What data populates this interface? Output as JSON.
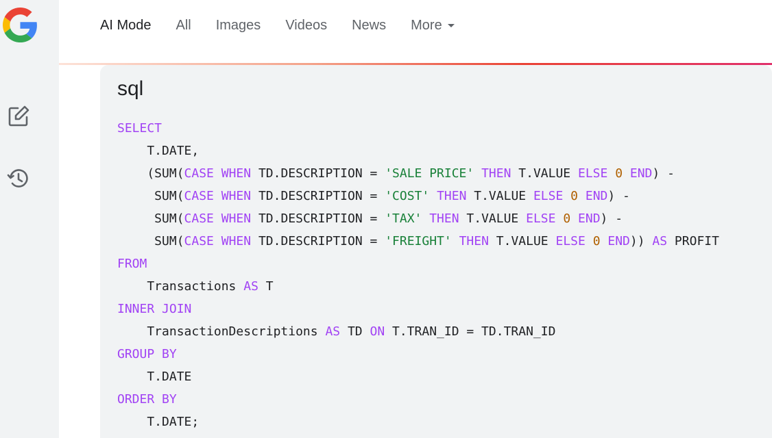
{
  "nav": {
    "tabs": [
      {
        "label": "AI Mode",
        "active": true
      },
      {
        "label": "All"
      },
      {
        "label": "Images"
      },
      {
        "label": "Videos"
      },
      {
        "label": "News"
      },
      {
        "label": "More"
      }
    ]
  },
  "sidebar": {
    "icons": [
      "new-chat-icon",
      "history-icon"
    ]
  },
  "code_block": {
    "language": "sql",
    "lines": [
      [
        [
          "SELECT",
          "k"
        ]
      ],
      [
        [
          "    T.DATE,",
          ""
        ]
      ],
      [
        [
          "    (SUM(",
          ""
        ],
        [
          "CASE",
          "k"
        ],
        [
          " ",
          ""
        ],
        [
          "WHEN",
          "k"
        ],
        [
          " TD.DESCRIPTION = ",
          ""
        ],
        [
          "'SALE PRICE'",
          "s"
        ],
        [
          " ",
          ""
        ],
        [
          "THEN",
          "k"
        ],
        [
          " T.VALUE ",
          ""
        ],
        [
          "ELSE",
          "k"
        ],
        [
          " ",
          ""
        ],
        [
          "0",
          "n"
        ],
        [
          " ",
          ""
        ],
        [
          "END",
          "k"
        ],
        [
          ") -",
          ""
        ]
      ],
      [
        [
          "     SUM(",
          ""
        ],
        [
          "CASE",
          "k"
        ],
        [
          " ",
          ""
        ],
        [
          "WHEN",
          "k"
        ],
        [
          " TD.DESCRIPTION = ",
          ""
        ],
        [
          "'COST'",
          "s"
        ],
        [
          " ",
          ""
        ],
        [
          "THEN",
          "k"
        ],
        [
          " T.VALUE ",
          ""
        ],
        [
          "ELSE",
          "k"
        ],
        [
          " ",
          ""
        ],
        [
          "0",
          "n"
        ],
        [
          " ",
          ""
        ],
        [
          "END",
          "k"
        ],
        [
          ") -",
          ""
        ]
      ],
      [
        [
          "     SUM(",
          ""
        ],
        [
          "CASE",
          "k"
        ],
        [
          " ",
          ""
        ],
        [
          "WHEN",
          "k"
        ],
        [
          " TD.DESCRIPTION = ",
          ""
        ],
        [
          "'TAX'",
          "s"
        ],
        [
          " ",
          ""
        ],
        [
          "THEN",
          "k"
        ],
        [
          " T.VALUE ",
          ""
        ],
        [
          "ELSE",
          "k"
        ],
        [
          " ",
          ""
        ],
        [
          "0",
          "n"
        ],
        [
          " ",
          ""
        ],
        [
          "END",
          "k"
        ],
        [
          ") -",
          ""
        ]
      ],
      [
        [
          "     SUM(",
          ""
        ],
        [
          "CASE",
          "k"
        ],
        [
          " ",
          ""
        ],
        [
          "WHEN",
          "k"
        ],
        [
          " TD.DESCRIPTION = ",
          ""
        ],
        [
          "'FREIGHT'",
          "s"
        ],
        [
          " ",
          ""
        ],
        [
          "THEN",
          "k"
        ],
        [
          " T.VALUE ",
          ""
        ],
        [
          "ELSE",
          "k"
        ],
        [
          " ",
          ""
        ],
        [
          "0",
          "n"
        ],
        [
          " ",
          ""
        ],
        [
          "END",
          "k"
        ],
        [
          ")) ",
          ""
        ],
        [
          "AS",
          "k"
        ],
        [
          " PROFIT",
          ""
        ]
      ],
      [
        [
          "FROM",
          "k"
        ]
      ],
      [
        [
          "    Transactions ",
          ""
        ],
        [
          "AS",
          "k"
        ],
        [
          " T",
          ""
        ]
      ],
      [
        [
          "INNER JOIN",
          "k"
        ]
      ],
      [
        [
          "    TransactionDescriptions ",
          ""
        ],
        [
          "AS",
          "k"
        ],
        [
          " TD ",
          ""
        ],
        [
          "ON",
          "k"
        ],
        [
          " T.TRAN_ID = TD.TRAN_ID",
          ""
        ]
      ],
      [
        [
          "GROUP BY",
          "k"
        ]
      ],
      [
        [
          "    T.DATE",
          ""
        ]
      ],
      [
        [
          "ORDER BY",
          "k"
        ]
      ],
      [
        [
          "    T.DATE;",
          ""
        ]
      ]
    ]
  },
  "colors": {
    "keyword": "#a142f4",
    "string": "#188038",
    "number": "#b06000",
    "text": "#202124"
  }
}
